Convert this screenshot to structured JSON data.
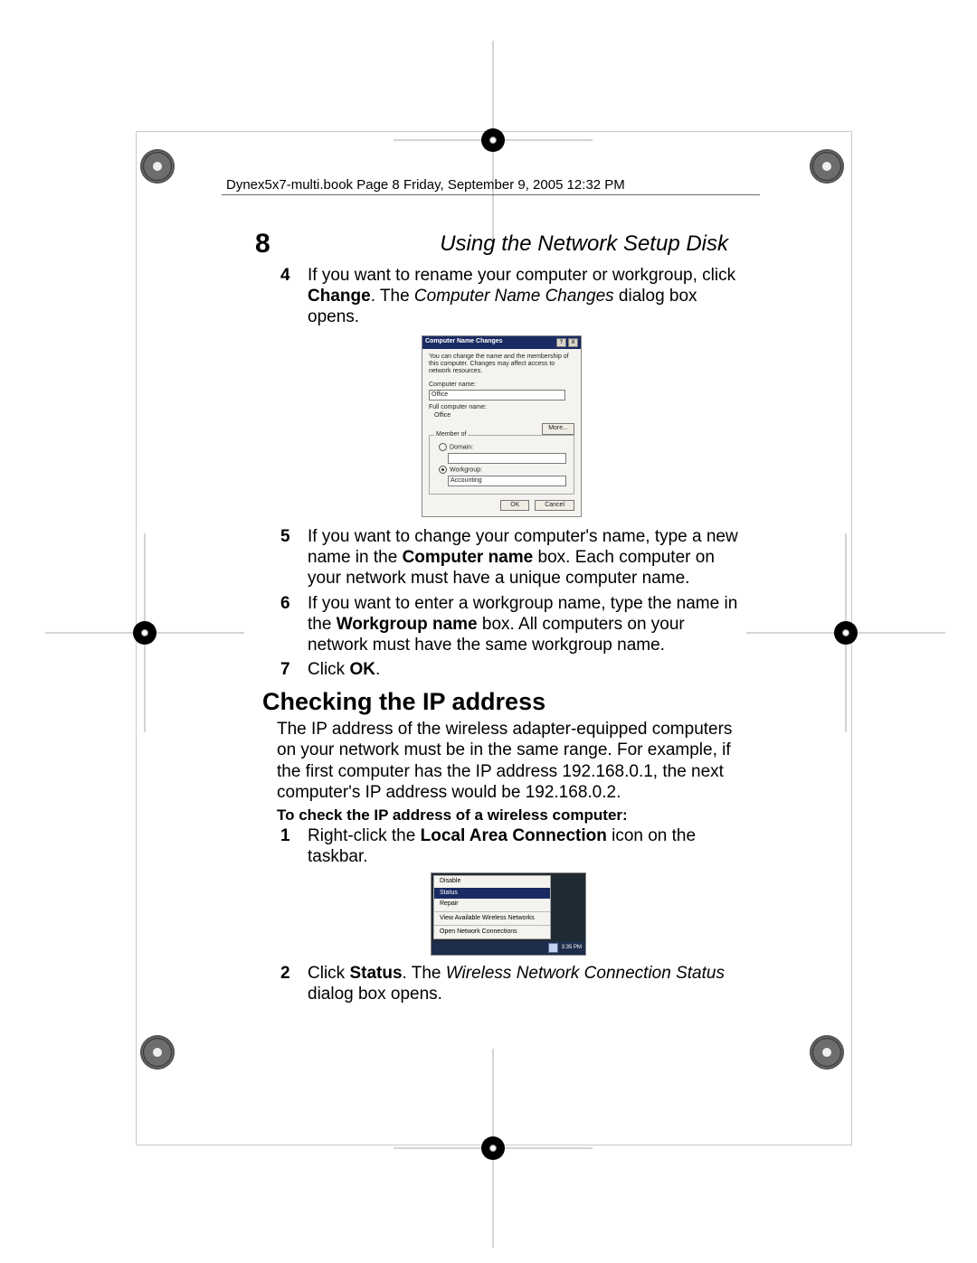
{
  "header": "Dynex5x7-multi.book  Page 8  Friday, September 9, 2005  12:32 PM",
  "pageNumber": "8",
  "pageTitle": "Using the Network Setup Disk",
  "steps1": {
    "s4": {
      "num": "4",
      "t1": "If you want to rename your computer or workgroup, click ",
      "bold1": "Change",
      "t2": ". The ",
      "italic1": "Computer Name Changes",
      "t3": " dialog box opens."
    },
    "s5": {
      "num": "5",
      "t1": "If you want to change your computer's name, type a new name in the ",
      "bold1": "Computer name",
      "t2": " box. Each computer on your network must have a unique computer name."
    },
    "s6": {
      "num": "6",
      "t1": "If you want to enter a workgroup name, type the name in the ",
      "bold1": "Workgroup name",
      "t2": " box. All computers on your network must have the same workgroup name."
    },
    "s7": {
      "num": "7",
      "t1": "Click ",
      "bold1": "OK",
      "t2": "."
    }
  },
  "section2": {
    "title": "Checking the IP address",
    "para": "The IP address of the wireless adapter-equipped computers on your network must be in the same range. For example, if the first computer has the IP address 192.168.0.1, the next computer's IP address would be 192.168.0.2.",
    "procTitle": "To check the IP address of a wireless computer:",
    "s1": {
      "num": "1",
      "t1": "Right-click the ",
      "bold1": "Local Area Connection",
      "t2": " icon on the taskbar."
    },
    "s2": {
      "num": "2",
      "t1": "Click ",
      "bold1": "Status",
      "t2": ". The ",
      "italic1": "Wireless Network Connection Status",
      "t3": " dialog box opens."
    }
  },
  "dialog": {
    "title": "Computer Name Changes",
    "desc": "You can change the name and the membership of this computer. Changes may affect access to network resources.",
    "labelCompName": "Computer name:",
    "valCompName": "Office",
    "labelFullName": "Full computer name:",
    "valFullName": "Office",
    "moreBtn": "More...",
    "groupLegend": "Member of",
    "radioDomain": "Domain:",
    "radioWorkgroup": "Workgroup:",
    "valWorkgroup": "Accounting",
    "okBtn": "OK",
    "cancelBtn": "Cancel"
  },
  "menu": {
    "m1": "Disable",
    "m2": "Status",
    "m3": "Repair",
    "m4": "View Available Wireless Networks",
    "m5": "Open Network Connections",
    "time": "3:35 PM"
  }
}
